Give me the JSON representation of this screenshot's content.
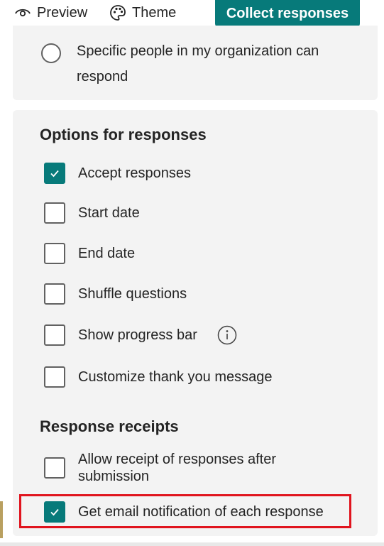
{
  "toolbar": {
    "preview_label": "Preview",
    "theme_label": "Theme",
    "collect_label": "Collect responses"
  },
  "audience": {
    "option_label": "Specific people in my organization can respond",
    "selected": false
  },
  "options_section": {
    "title": "Options for responses",
    "items": [
      {
        "label": "Accept responses",
        "checked": true
      },
      {
        "label": "Start date",
        "checked": false
      },
      {
        "label": "End date",
        "checked": false
      },
      {
        "label": "Shuffle questions",
        "checked": false
      },
      {
        "label": "Show progress bar",
        "checked": false,
        "info_icon": "info-icon"
      },
      {
        "label": "Customize thank you message",
        "checked": false
      }
    ]
  },
  "receipts_section": {
    "title": "Response receipts",
    "items": [
      {
        "label": "Allow receipt of responses after submission",
        "checked": false
      },
      {
        "label": "Get email notification of each response",
        "checked": true
      }
    ]
  },
  "colors": {
    "accent": "#077a7a",
    "panel_bg": "#f3f3f3",
    "highlight": "#e0141e"
  }
}
